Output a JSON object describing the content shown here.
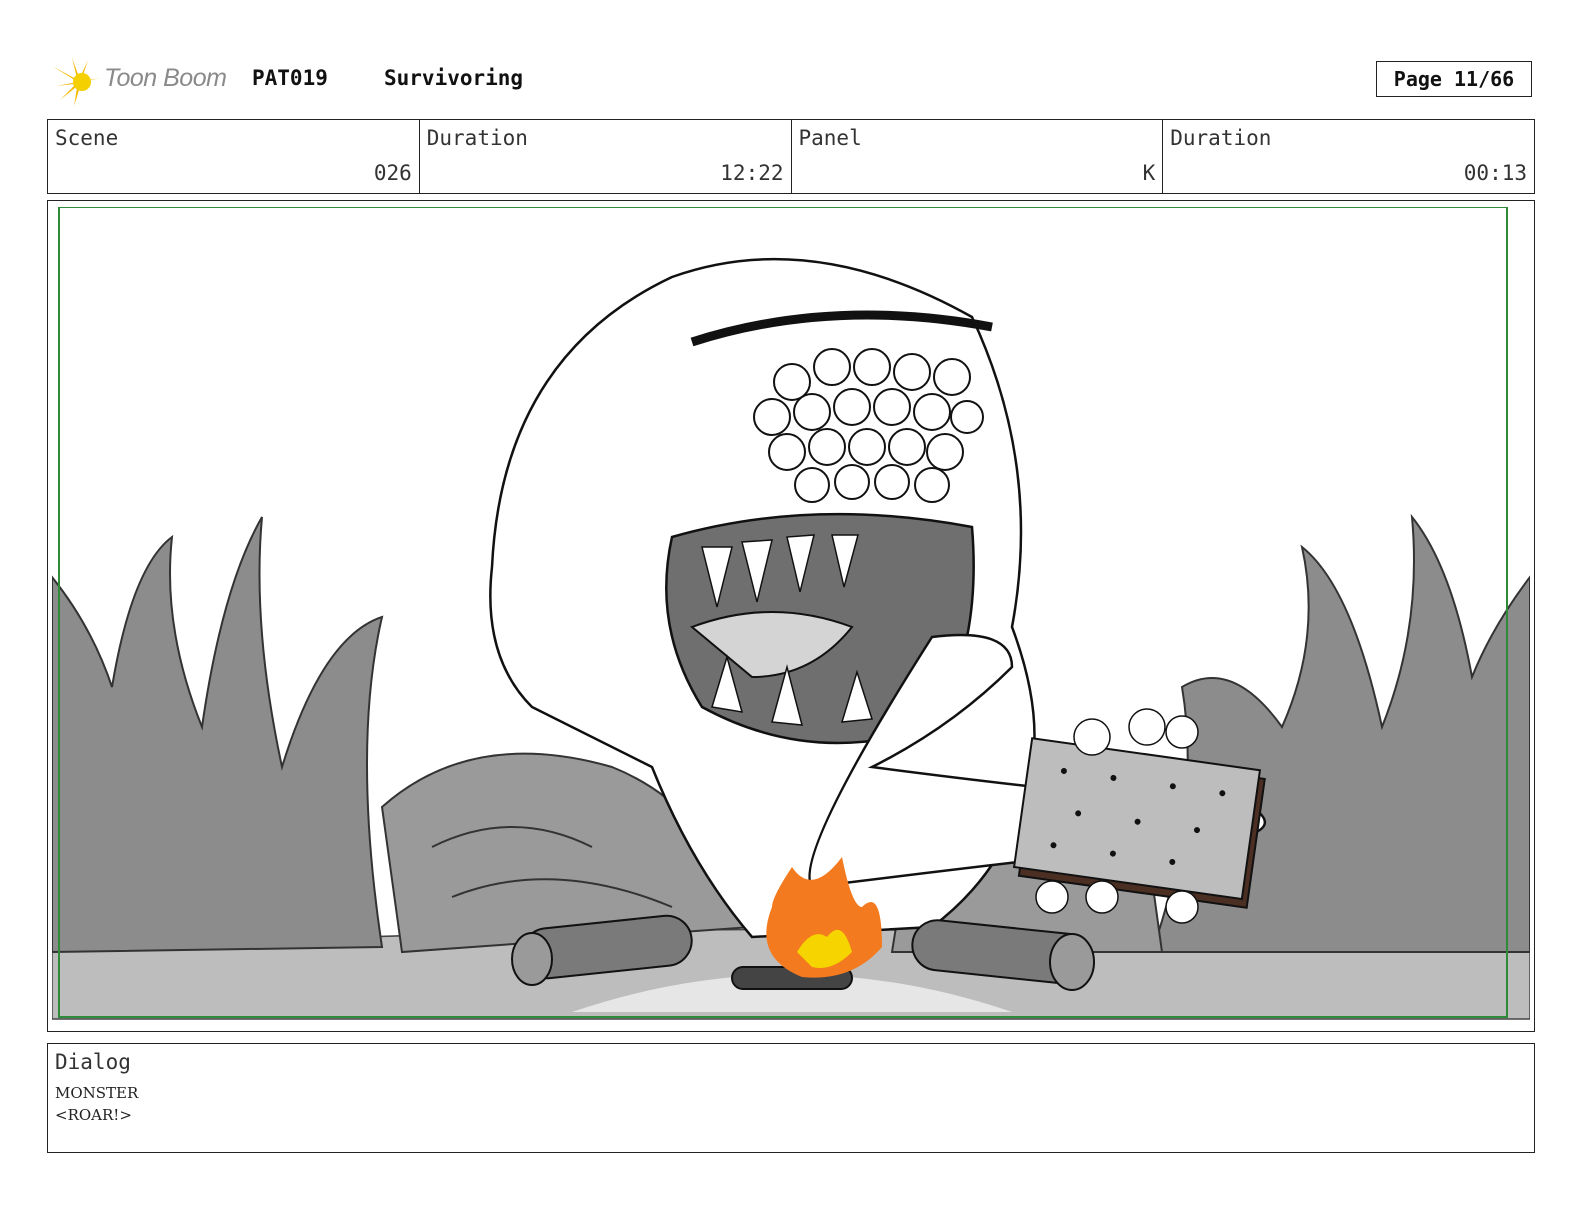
{
  "header": {
    "brand": "Toon Boom",
    "project_code": "PAT019",
    "project_title": "Survivoring",
    "page": "Page 11/66"
  },
  "info": {
    "scene_label": "Scene",
    "scene_value": "026",
    "scene_duration_label": "Duration",
    "scene_duration_value": "12:22",
    "panel_label": "Panel",
    "panel_value": "K",
    "panel_duration_label": "Duration",
    "panel_duration_value": "00:13"
  },
  "panel_image": {
    "icon": "storyboard-sketch",
    "colors": {
      "frame": "#2e8b3a",
      "flame_outer": "#f47a1f",
      "flame_inner": "#f5d400",
      "foliage": "#8c8c8c",
      "ground": "#bdbdbd"
    }
  },
  "dialog": {
    "label": "Dialog",
    "lines": [
      "MONSTER",
      "<ROAR!>"
    ]
  }
}
